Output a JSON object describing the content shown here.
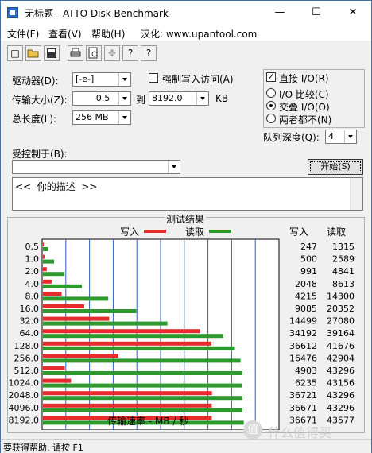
{
  "window": {
    "title": "无标题 - ATTO Disk Benchmark",
    "minimize": "—",
    "maximize": "☐",
    "close": "✕"
  },
  "menu": [
    "文件(F)",
    "查看(V)",
    "帮助(H)",
    "汉化: www.upantool.com"
  ],
  "toolbar": {
    "icons": [
      "new-icon",
      "open-icon",
      "save-icon",
      "print-icon",
      "print-preview-icon",
      "move-icon",
      "help-icon",
      "context-help-icon"
    ],
    "glyphs": [
      "□",
      "📂",
      "💾",
      "🖶",
      "🔍",
      "✥",
      "?",
      "?"
    ]
  },
  "settings": {
    "drive_label": "驱动器(D):",
    "drive_value": "[-e-]",
    "force_write_label": "强制写入访问(A)",
    "transfer_size_label": "传输大小(Z):",
    "transfer_from": "0.5",
    "to_label": "到",
    "transfer_to": "8192.0",
    "kb_label": "KB",
    "total_length_label": "总长度(L):",
    "total_length_value": "256 MB",
    "direct_io_label": "直接 I/O(R)",
    "direct_io_checked": true,
    "io_compare_label": "I/O 比较(C)",
    "overlap_io_label": "交叠 I/O(O)",
    "neither_label": "两者都不(N)",
    "selected_mode": "overlap",
    "queue_depth_label": "队列深度(Q):",
    "queue_depth_value": "4",
    "controlled_by_label": "受控制于(B):",
    "controlled_by_value": "",
    "start_button": "开始(S)",
    "description": "<<  你的描述  >>"
  },
  "results": {
    "title": "测试结果",
    "write_legend": "写入",
    "read_legend": "读取",
    "write_col": "写入",
    "read_col": "读取",
    "write_color": "#e52b2b",
    "read_color": "#2e9a2e",
    "xlabel": "传输速率 - MB / 秒"
  },
  "chart_data": {
    "type": "bar",
    "orientation": "horizontal",
    "title": "测试结果",
    "xlabel": "传输速率 - MB / 秒",
    "xlim": [
      0,
      50
    ],
    "xticks": [
      "0",
      "5",
      "10",
      "15",
      "20",
      "25",
      "30",
      "35",
      "40",
      "45",
      "50"
    ],
    "categories": [
      "0.5",
      "1.0",
      "2.0",
      "4.0",
      "8.0",
      "16.0",
      "32.0",
      "64.0",
      "128.0",
      "256.0",
      "512.0",
      "1024.0",
      "2048.0",
      "4096.0",
      "8192.0"
    ],
    "series": [
      {
        "name": "写入",
        "values_mb": [
          0.24,
          0.49,
          0.97,
          2.0,
          4.12,
          8.88,
          14.16,
          33.39,
          35.75,
          16.09,
          4.79,
          6.09,
          35.86,
          35.81,
          35.81
        ],
        "labels": [
          "247",
          "500",
          "991",
          "2048",
          "4215",
          "9085",
          "14499",
          "34192",
          "36612",
          "16476",
          "4903",
          "6235",
          "36721",
          "36671",
          "36671"
        ]
      },
      {
        "name": "读取",
        "values_mb": [
          1.28,
          2.53,
          4.73,
          8.41,
          13.96,
          19.88,
          26.45,
          38.25,
          40.7,
          41.88,
          42.28,
          42.14,
          42.28,
          42.28,
          42.56
        ],
        "labels": [
          "1315",
          "2589",
          "4841",
          "8613",
          "14300",
          "20352",
          "27080",
          "39164",
          "41676",
          "42904",
          "43296",
          "43156",
          "43296",
          "43296",
          "43577"
        ]
      }
    ],
    "grid": true,
    "legend": "top"
  },
  "status": {
    "text": "要获得帮助, 请按 F1"
  },
  "watermark": {
    "glyph": "值",
    "text": "什么值得买"
  }
}
